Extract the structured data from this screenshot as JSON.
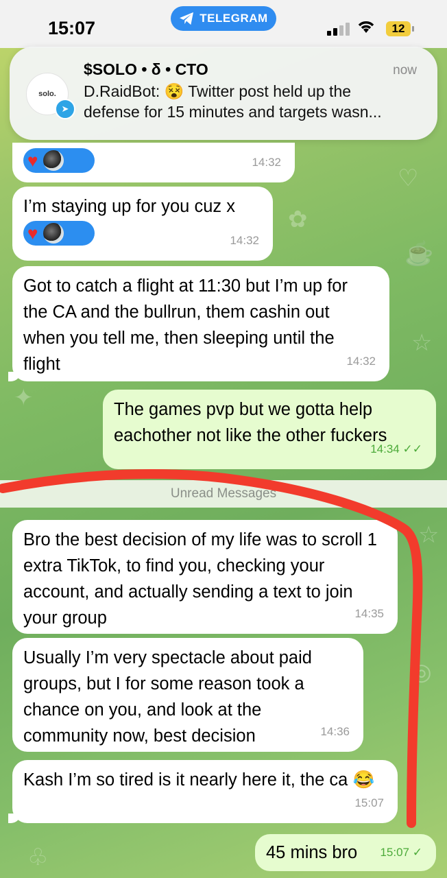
{
  "status_bar": {
    "time": "15:07",
    "app_pill": "TELEGRAM",
    "battery": "12"
  },
  "notification": {
    "avatar_text": "solo.",
    "title": "$SOLO • δ • CTO",
    "time": "now",
    "body": "D.RaidBot: 😵 Twitter post held up the\ndefense for 15 minutes and targets wasn..."
  },
  "messages": [
    {
      "text": "",
      "time": "14:32",
      "direction": "in"
    },
    {
      "text": "I’m staying up for you cuz x",
      "time": "14:32",
      "direction": "in"
    },
    {
      "text": "Got to catch a flight at 11:30 but I’m up for the CA and the bullrun, them cashin out when you tell me, then sleeping until the flight",
      "time": "14:32",
      "direction": "in"
    },
    {
      "text": "The games pvp but we gotta help eachother not like the other fuckers",
      "time": "14:34",
      "direction": "out",
      "status": "✓✓"
    },
    {
      "text": "Bro the best decision of my life was to scroll 1 extra TikTok, to find you, checking your account, and actually sending a text to join your group",
      "time": "14:35",
      "direction": "in"
    },
    {
      "text": "Usually I’m very spectacle about paid groups, but I for some reason took a chance on you, and look at the community now, best decision",
      "time": "14:36",
      "direction": "in"
    },
    {
      "text": "Kash I’m so tired is it nearly here it, the ca 😂",
      "time": "15:07",
      "direction": "in"
    },
    {
      "text": "45 mins bro",
      "time": "15:07",
      "direction": "out",
      "status": "✓"
    }
  ],
  "divider": "Unread Messages",
  "colors": {
    "incoming_bubble": "#ffffff",
    "outgoing_bubble": "#e6fccf",
    "reaction_pill": "#2c8ef0",
    "annotation_red": "#f23b2c"
  }
}
